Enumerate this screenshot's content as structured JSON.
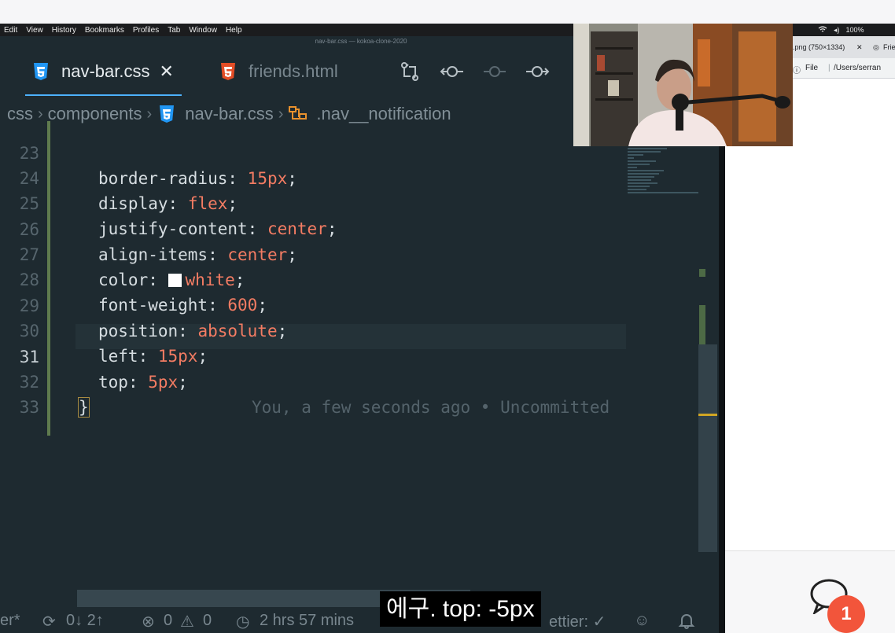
{
  "menubar": {
    "items": [
      "Edit",
      "View",
      "History",
      "Bookmarks",
      "Profiles",
      "Tab",
      "Window",
      "Help"
    ],
    "battery": "100%"
  },
  "editor": {
    "window_title": "nav-bar.css — kokoa-clone-2020",
    "tabs": [
      {
        "label": "nav-bar.css",
        "icon": "css3-icon",
        "active": true
      },
      {
        "label": "friends.html",
        "icon": "html5-icon",
        "active": false
      }
    ],
    "breadcrumb": {
      "items": [
        "css",
        "components",
        "nav-bar.css",
        ".nav__notification"
      ]
    },
    "lines": [
      {
        "num": "23",
        "prop": "border-radius",
        "val": "15px"
      },
      {
        "num": "24",
        "prop": "display",
        "val": "flex"
      },
      {
        "num": "25",
        "prop": "justify-content",
        "val": "center"
      },
      {
        "num": "26",
        "prop": "align-items",
        "val": "center"
      },
      {
        "num": "27",
        "prop": "color",
        "val": "white"
      },
      {
        "num": "28",
        "prop": "font-weight",
        "val": "600"
      },
      {
        "num": "29",
        "prop": "position",
        "val": "absolute"
      },
      {
        "num": "30",
        "prop": "left",
        "val": "15px"
      },
      {
        "num": "31",
        "prop": "top",
        "val": "5px"
      },
      {
        "num": "32",
        "brace": "}"
      },
      {
        "num": "33"
      }
    ],
    "blame": "You, a few seconds ago • Uncommitted",
    "colors": {
      "value": "#f47c63",
      "text": "#d6dde1",
      "accent": "#4db2ff",
      "css_icon": "#2196f3",
      "html_icon": "#e44d26"
    }
  },
  "statusbar": {
    "branch": "er*",
    "sync": "0↓ 2↑",
    "errors": "0",
    "warnings": "0",
    "time": "2 hrs 57 mins",
    "prettier": "ettier: ✓"
  },
  "browser": {
    "tab_label": ".png (750×1334)",
    "tab2_label": "Frie",
    "address_prefix": "File",
    "address": "/Users/serran",
    "notification_count": "1"
  },
  "subtitle": "에구. top: -5px"
}
